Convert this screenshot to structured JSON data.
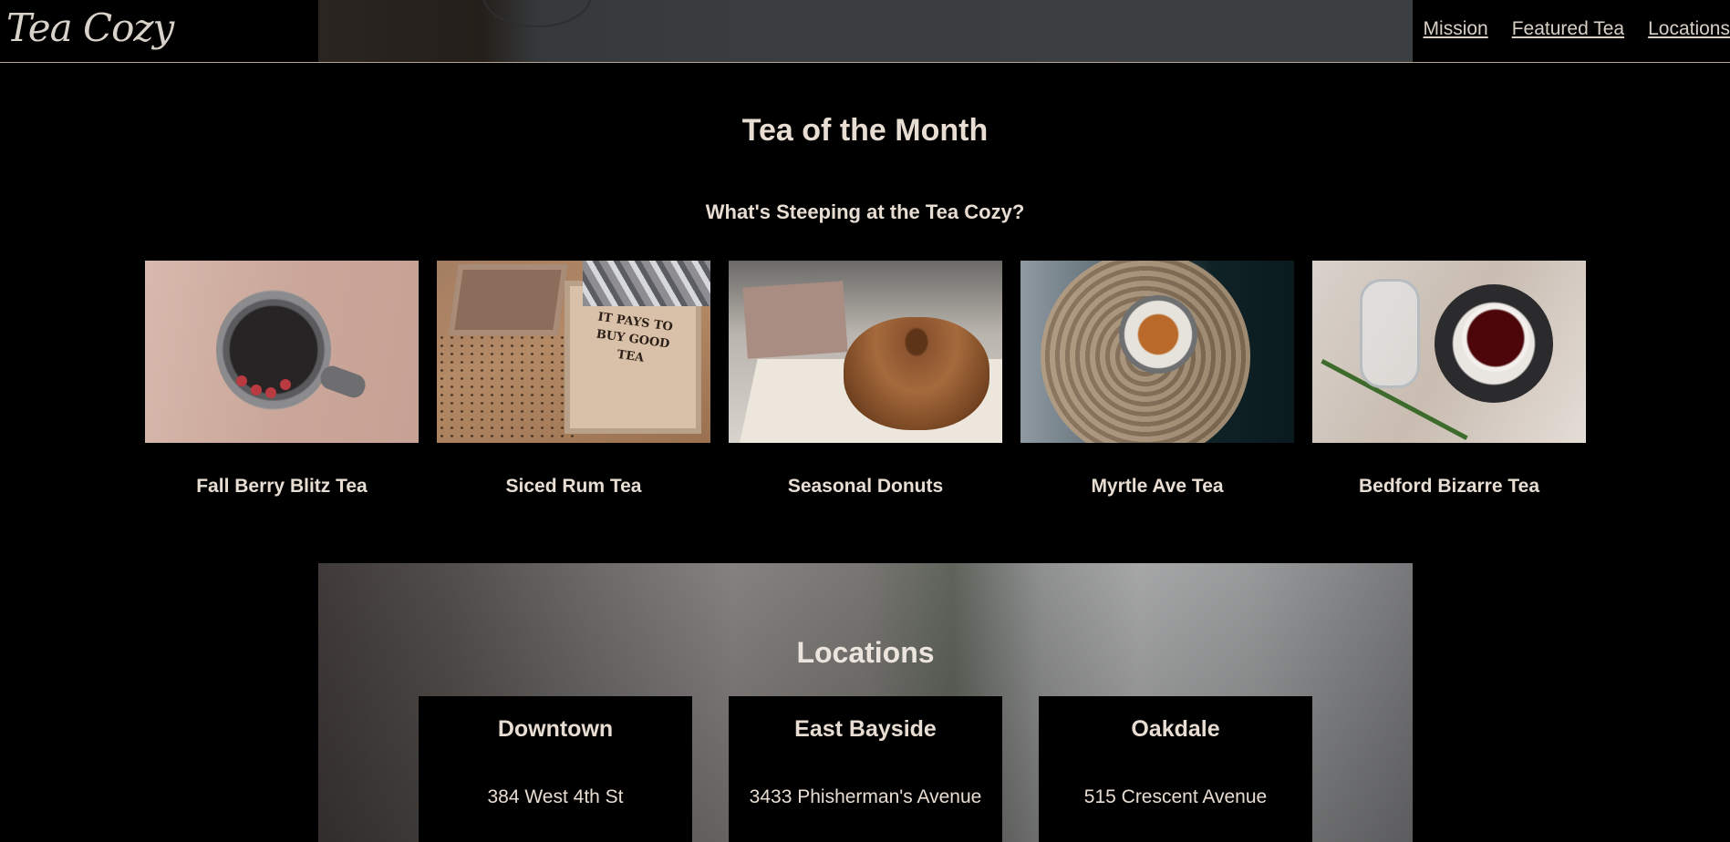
{
  "header": {
    "logo": "Tea Cozy",
    "nav": [
      {
        "label": "Mission"
      },
      {
        "label": "Featured Tea"
      },
      {
        "label": "Locations"
      }
    ]
  },
  "tea_of_month": {
    "title": "Tea of the Month",
    "subtitle": "What's Steeping at the Tea Cozy?",
    "image_sign_text": "IT PAYS TO BUY GOOD TEA",
    "items": [
      {
        "name": "Fall Berry Blitz Tea"
      },
      {
        "name": "Siced Rum Tea"
      },
      {
        "name": "Seasonal Donuts"
      },
      {
        "name": "Myrtle Ave Tea"
      },
      {
        "name": "Bedford Bizarre Tea"
      }
    ]
  },
  "locations": {
    "title": "Locations",
    "stores": [
      {
        "name": "Downtown",
        "address": "384 West 4th St"
      },
      {
        "name": "East Bayside",
        "address": "3433 Phisherman's Avenue"
      },
      {
        "name": "Oakdale",
        "address": "515 Crescent Avenue"
      }
    ]
  },
  "colors": {
    "background": "#000000",
    "text": "#e8ddd2",
    "header_border": "#b5a48f"
  }
}
